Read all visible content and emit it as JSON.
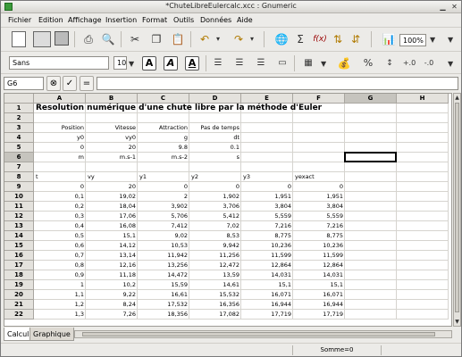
{
  "window": {
    "title": "*ChuteLibreEulercalc.xcc : Gnumeric"
  },
  "menubar": [
    "Fichier",
    "Edition",
    "Affichage",
    "Insertion",
    "Format",
    "Outils",
    "Données",
    "Aide"
  ],
  "toolbar": {
    "zoom": "100%",
    "font_name": "Sans",
    "font_size": "10"
  },
  "formula_bar": {
    "cell_ref": "G6",
    "equals_label": "=",
    "content": ""
  },
  "sheet": {
    "columns": [
      "A",
      "B",
      "C",
      "D",
      "E",
      "F",
      "G",
      "H"
    ],
    "selected_column": "G",
    "selected_row": "6",
    "rows": [
      "1",
      "2",
      "3",
      "4",
      "5",
      "6",
      "7",
      "8",
      "9",
      "10",
      "11",
      "12",
      "13",
      "14",
      "15",
      "16",
      "17",
      "18",
      "19",
      "20",
      "21",
      "22"
    ],
    "title": "Resolution numérique d'une chute libre par la méthode d'Euler",
    "r3": [
      "Position",
      "Vitesse",
      "Attraction",
      "Pas de temps"
    ],
    "r4": [
      "y0",
      "vy0",
      "g",
      "dt"
    ],
    "r5": [
      "0",
      "20",
      "9.8",
      "0.1"
    ],
    "r6": [
      "m",
      "m.s-1",
      "m.s-2",
      "s"
    ],
    "r8": [
      "t",
      "vy",
      "y1",
      "y2",
      "y3",
      "yexact"
    ],
    "data": [
      [
        "0",
        "20",
        "0",
        "0",
        "0",
        "0"
      ],
      [
        "0,1",
        "19,02",
        "2",
        "1,902",
        "1,951",
        "1,951"
      ],
      [
        "0,2",
        "18,04",
        "3,902",
        "3,706",
        "3,804",
        "3,804"
      ],
      [
        "0,3",
        "17,06",
        "5,706",
        "5,412",
        "5,559",
        "5,559"
      ],
      [
        "0,4",
        "16,08",
        "7,412",
        "7,02",
        "7,216",
        "7,216"
      ],
      [
        "0,5",
        "15,1",
        "9,02",
        "8,53",
        "8,775",
        "8,775"
      ],
      [
        "0,6",
        "14,12",
        "10,53",
        "9,942",
        "10,236",
        "10,236"
      ],
      [
        "0,7",
        "13,14",
        "11,942",
        "11,256",
        "11,599",
        "11,599"
      ],
      [
        "0,8",
        "12,16",
        "13,256",
        "12,472",
        "12,864",
        "12,864"
      ],
      [
        "0,9",
        "11,18",
        "14,472",
        "13,59",
        "14,031",
        "14,031"
      ],
      [
        "1",
        "10,2",
        "15,59",
        "14,61",
        "15,1",
        "15,1"
      ],
      [
        "1,1",
        "9,22",
        "16,61",
        "15,532",
        "16,071",
        "16,071"
      ],
      [
        "1,2",
        "8,24",
        "17,532",
        "16,356",
        "16,944",
        "16,944"
      ],
      [
        "1,3",
        "7,26",
        "18,356",
        "17,082",
        "17,719",
        "17,719"
      ]
    ]
  },
  "tabs": [
    "Calcul",
    "Graphique"
  ],
  "status": "Somme=0"
}
